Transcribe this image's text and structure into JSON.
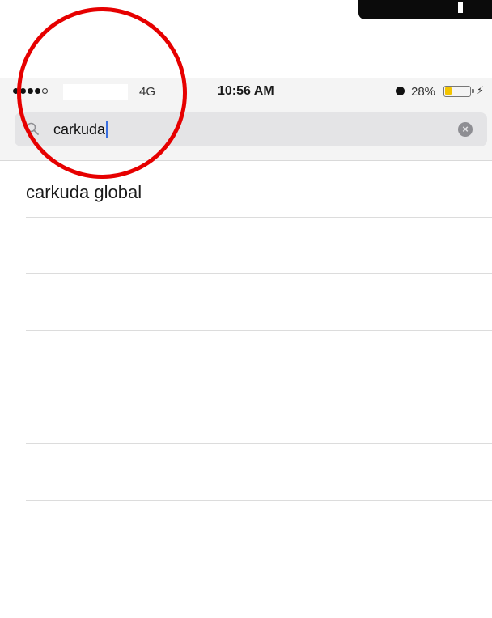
{
  "status_bar": {
    "network": "4G",
    "time": "10:56 AM",
    "battery_percent": "28%",
    "battery_level": 0.28,
    "battery_color": "#f3c400"
  },
  "search": {
    "query": "carkuda",
    "icon": "search-icon",
    "clear_icon": "clear-icon"
  },
  "results": [
    {
      "label": "carkuda global"
    },
    {
      "label": ""
    },
    {
      "label": ""
    },
    {
      "label": ""
    },
    {
      "label": ""
    },
    {
      "label": ""
    },
    {
      "label": ""
    }
  ],
  "annotation": {
    "shape": "circle",
    "color": "#e60000"
  }
}
